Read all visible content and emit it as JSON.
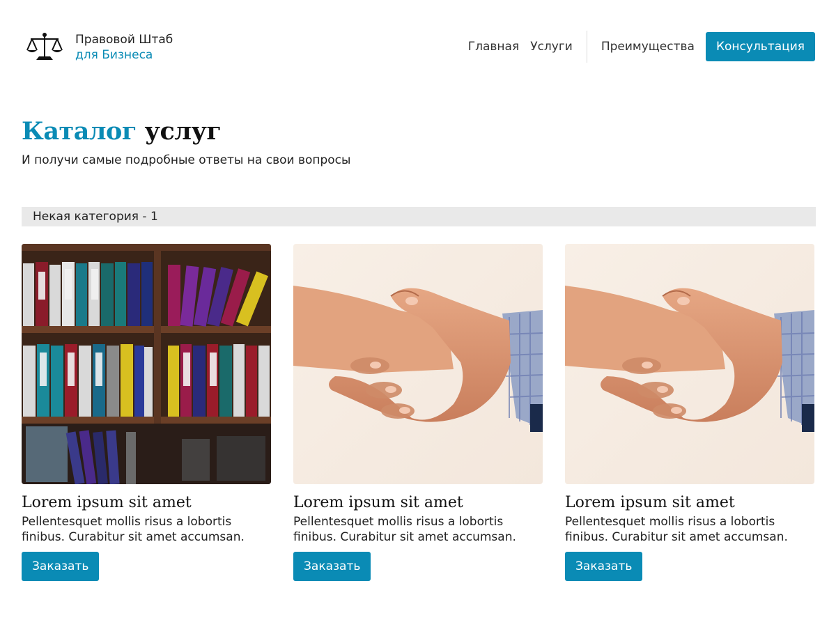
{
  "brand": {
    "name": "Правовой Штаб",
    "tagline": "для Бизнеса",
    "accent_color": "#0a8bb5",
    "icon": "scales-icon"
  },
  "nav": {
    "items": [
      "Главная",
      "Услуги",
      "Преимущества"
    ],
    "cta_label": "Консультация"
  },
  "catalog": {
    "title_accent": "Каталог",
    "title_rest": "услуг",
    "subtitle": "И получи самые подробные ответы на свои вопросы"
  },
  "category": {
    "label": "Некая категория - 1"
  },
  "cards": [
    {
      "image": "bookshelf-binders-image",
      "title": "Lorem ipsum sit amet",
      "description": "Pellentesquet mollis risus a lobortis finibus. Curabitur sit amet accumsan.",
      "button": "Заказать"
    },
    {
      "image": "handshake-image",
      "title": "Lorem ipsum sit amet",
      "description": "Pellentesquet mollis risus a lobortis finibus. Curabitur sit amet accumsan.",
      "button": "Заказать"
    },
    {
      "image": "handshake-image",
      "title": "Lorem ipsum sit amet",
      "description": "Pellentesquet mollis risus a lobortis finibus. Curabitur sit amet accumsan.",
      "button": "Заказать"
    }
  ]
}
